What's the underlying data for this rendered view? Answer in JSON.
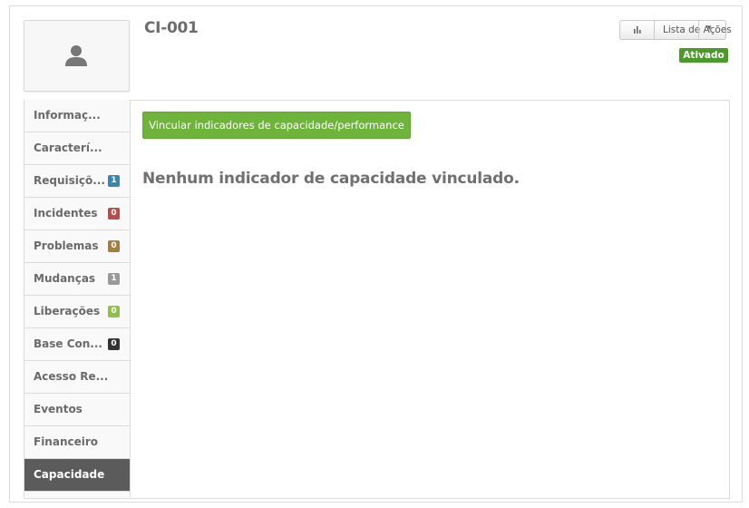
{
  "header": {
    "title": "CI-001",
    "actions_label": "Lista de Ações",
    "status": "Ativado",
    "status_color": "#4c9a2a"
  },
  "sidebar": {
    "items": [
      {
        "label": "Informaç...",
        "badge": null
      },
      {
        "label": "Caracterí...",
        "badge": null
      },
      {
        "label": "Requisiçõ...",
        "badge": "1",
        "badge_color": "#3a87ad"
      },
      {
        "label": "Incidentes",
        "badge": "0",
        "badge_color": "#b94a48"
      },
      {
        "label": "Problemas",
        "badge": "0",
        "badge_color": "#a47e3c"
      },
      {
        "label": "Mudanças",
        "badge": "1",
        "badge_color": "#999999"
      },
      {
        "label": "Liberações",
        "badge": "0",
        "badge_color": "#8bc34a"
      },
      {
        "label": "Base Con...",
        "badge": "0",
        "badge_color": "#333333"
      },
      {
        "label": "Acesso Re...",
        "badge": null
      },
      {
        "label": "Eventos",
        "badge": null
      },
      {
        "label": "Financeiro",
        "badge": null
      },
      {
        "label": "Capacidade",
        "badge": null,
        "active": true
      }
    ]
  },
  "main": {
    "link_button": "Vincular indicadores de capacidade/performance",
    "empty_message": "Nenhum indicador de capacidade vinculado."
  },
  "icons": {
    "avatar": "user-icon",
    "chart": "bar-chart-icon",
    "caret": "caret-down-icon"
  }
}
